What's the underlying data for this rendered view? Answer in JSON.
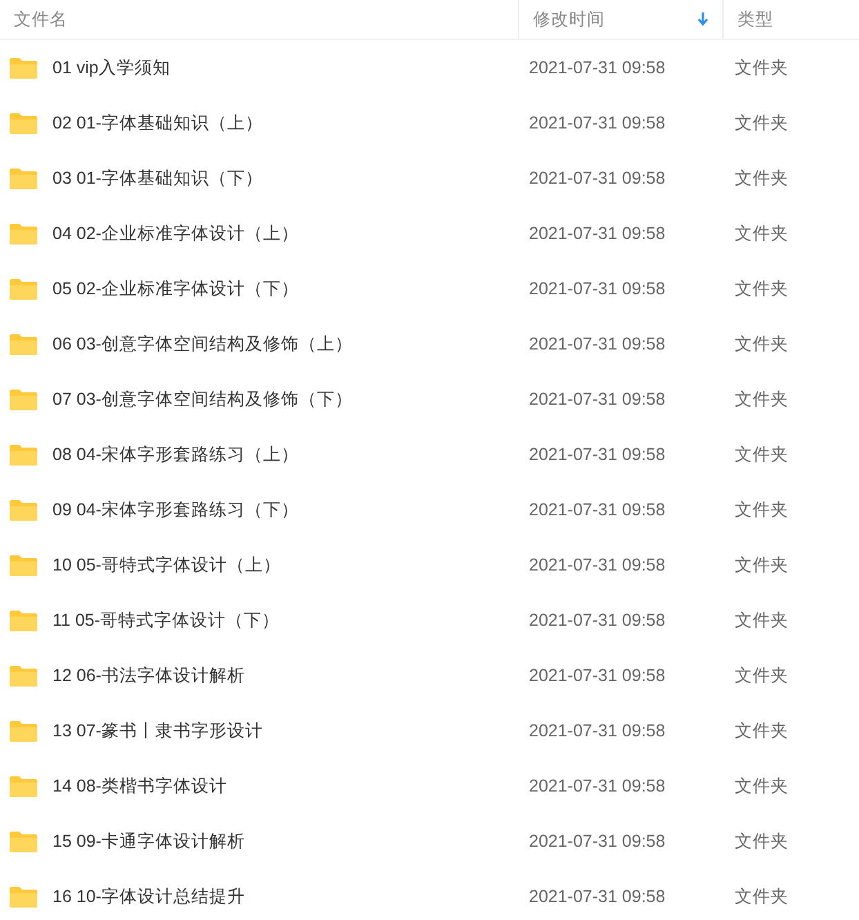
{
  "columns": [
    {
      "label": "文件名",
      "sorted": false
    },
    {
      "label": "修改时间",
      "sorted": true
    },
    {
      "label": "类型",
      "sorted": false
    }
  ],
  "rows": [
    {
      "name": "01 vip入学须知",
      "modified": "2021-07-31 09:58",
      "type": "文件夹"
    },
    {
      "name": "02 01-字体基础知识（上）",
      "modified": "2021-07-31 09:58",
      "type": "文件夹"
    },
    {
      "name": "03 01-字体基础知识（下）",
      "modified": "2021-07-31 09:58",
      "type": "文件夹"
    },
    {
      "name": "04 02-企业标准字体设计（上）",
      "modified": "2021-07-31 09:58",
      "type": "文件夹"
    },
    {
      "name": "05 02-企业标准字体设计（下）",
      "modified": "2021-07-31 09:58",
      "type": "文件夹"
    },
    {
      "name": "06 03-创意字体空间结构及修饰（上）",
      "modified": "2021-07-31 09:58",
      "type": "文件夹"
    },
    {
      "name": "07 03-创意字体空间结构及修饰（下）",
      "modified": "2021-07-31 09:58",
      "type": "文件夹"
    },
    {
      "name": "08 04-宋体字形套路练习（上）",
      "modified": "2021-07-31 09:58",
      "type": "文件夹"
    },
    {
      "name": "09 04-宋体字形套路练习（下）",
      "modified": "2021-07-31 09:58",
      "type": "文件夹"
    },
    {
      "name": "10 05-哥特式字体设计（上）",
      "modified": "2021-07-31 09:58",
      "type": "文件夹"
    },
    {
      "name": "11 05-哥特式字体设计（下）",
      "modified": "2021-07-31 09:58",
      "type": "文件夹"
    },
    {
      "name": "12 06-书法字体设计解析",
      "modified": "2021-07-31 09:58",
      "type": "文件夹"
    },
    {
      "name": "13 07-篆书丨隶书字形设计",
      "modified": "2021-07-31 09:58",
      "type": "文件夹"
    },
    {
      "name": "14 08-类楷书字体设计",
      "modified": "2021-07-31 09:58",
      "type": "文件夹"
    },
    {
      "name": "15 09-卡通字体设计解析",
      "modified": "2021-07-31 09:58",
      "type": "文件夹"
    },
    {
      "name": "16 10-字体设计总结提升",
      "modified": "2021-07-31 09:58",
      "type": "文件夹"
    }
  ]
}
